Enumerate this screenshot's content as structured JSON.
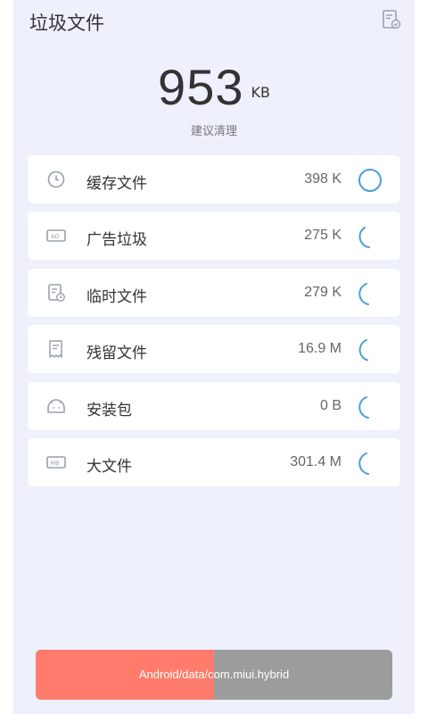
{
  "header": {
    "title": "垃圾文件",
    "action_icon": "report-icon"
  },
  "summary": {
    "size": "953",
    "unit": "KB",
    "hint": "建议清理"
  },
  "items": [
    {
      "label": "缓存文件",
      "value": "398 K",
      "icon": "clock-icon"
    },
    {
      "label": "广告垃圾",
      "value": "275 K",
      "icon": "ad-icon"
    },
    {
      "label": "临时文件",
      "value": "279 K",
      "icon": "temp-file-icon"
    },
    {
      "label": "残留文件",
      "value": "16.9 M",
      "icon": "residual-file-icon"
    },
    {
      "label": "安装包",
      "value": "0 B",
      "icon": "android-icon"
    },
    {
      "label": "大文件",
      "value": "301.4 M",
      "icon": "mb-icon"
    }
  ],
  "scan": {
    "path": "Android/data/com.miui.hybrid",
    "progress": 0.5
  },
  "colors": {
    "background": "#eef0fb",
    "card": "#ffffff",
    "spinner": "#4a9fd8",
    "progress_fill": "#ff7b6b",
    "progress_rest": "#9c9c9c"
  }
}
